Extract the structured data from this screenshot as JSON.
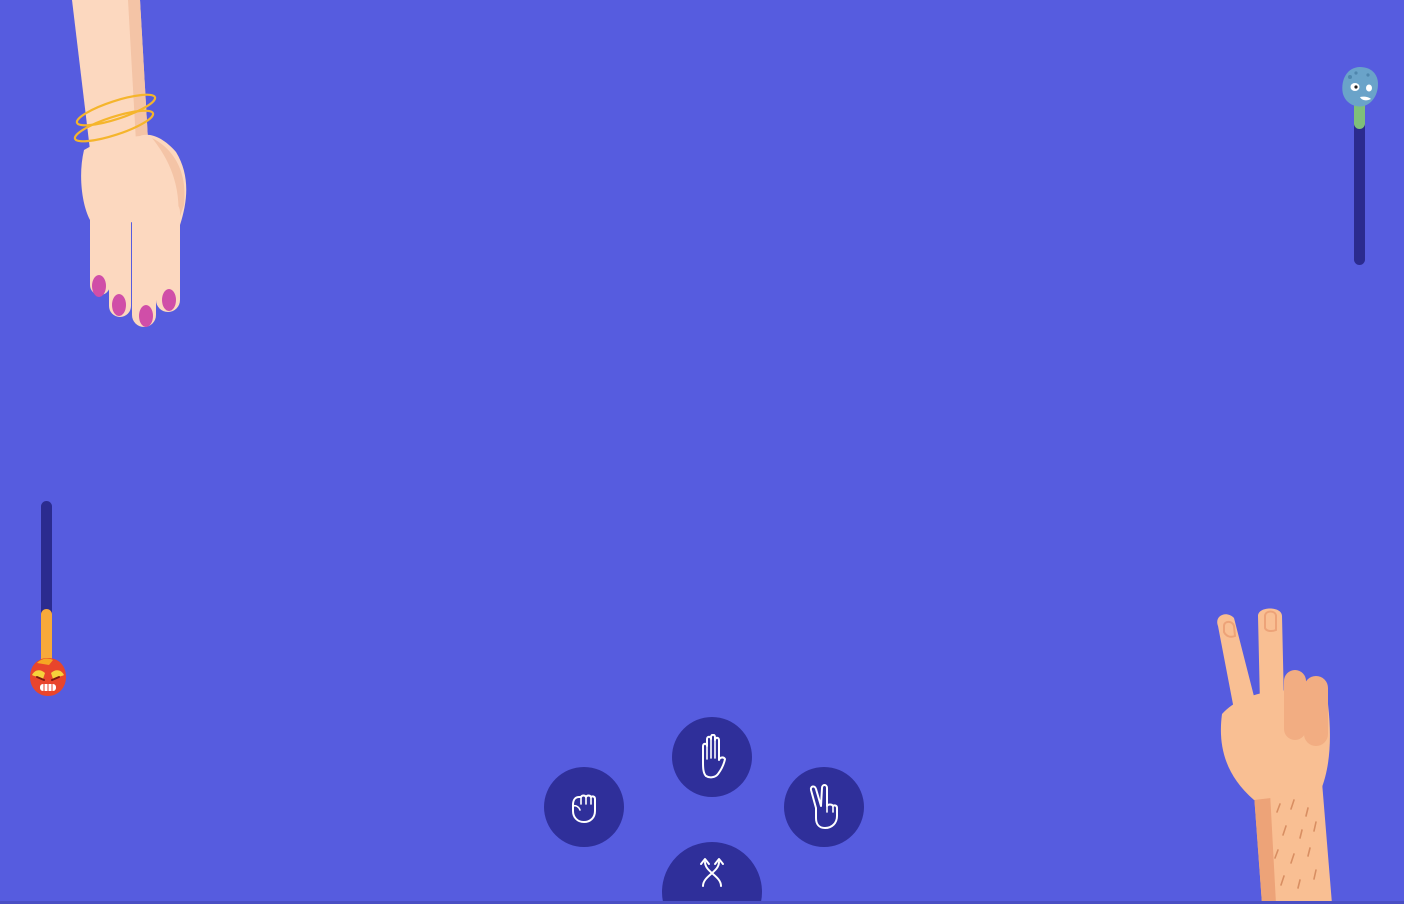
{
  "colors": {
    "background": "#565cdf",
    "bar_track": "#2b2b8f",
    "button": "#2f2f9a",
    "player_bar": "#f8a93a",
    "opponent_bar": "#7fbf7a"
  },
  "opponent": {
    "avatar_icon": "blue-zombie-face-icon",
    "hand_icon": "open-hand-paper-icon",
    "health_fraction": 0.23
  },
  "player": {
    "avatar_icon": "red-angry-face-icon",
    "hand_icon": "peace-hand-scissors-icon",
    "health_fraction": 0.4
  },
  "controls": {
    "rock_icon": "fist-rock-icon",
    "paper_icon": "open-hand-paper-icon",
    "scissors_icon": "two-finger-scissors-icon",
    "random_icon": "shuffle-arrows-icon"
  }
}
